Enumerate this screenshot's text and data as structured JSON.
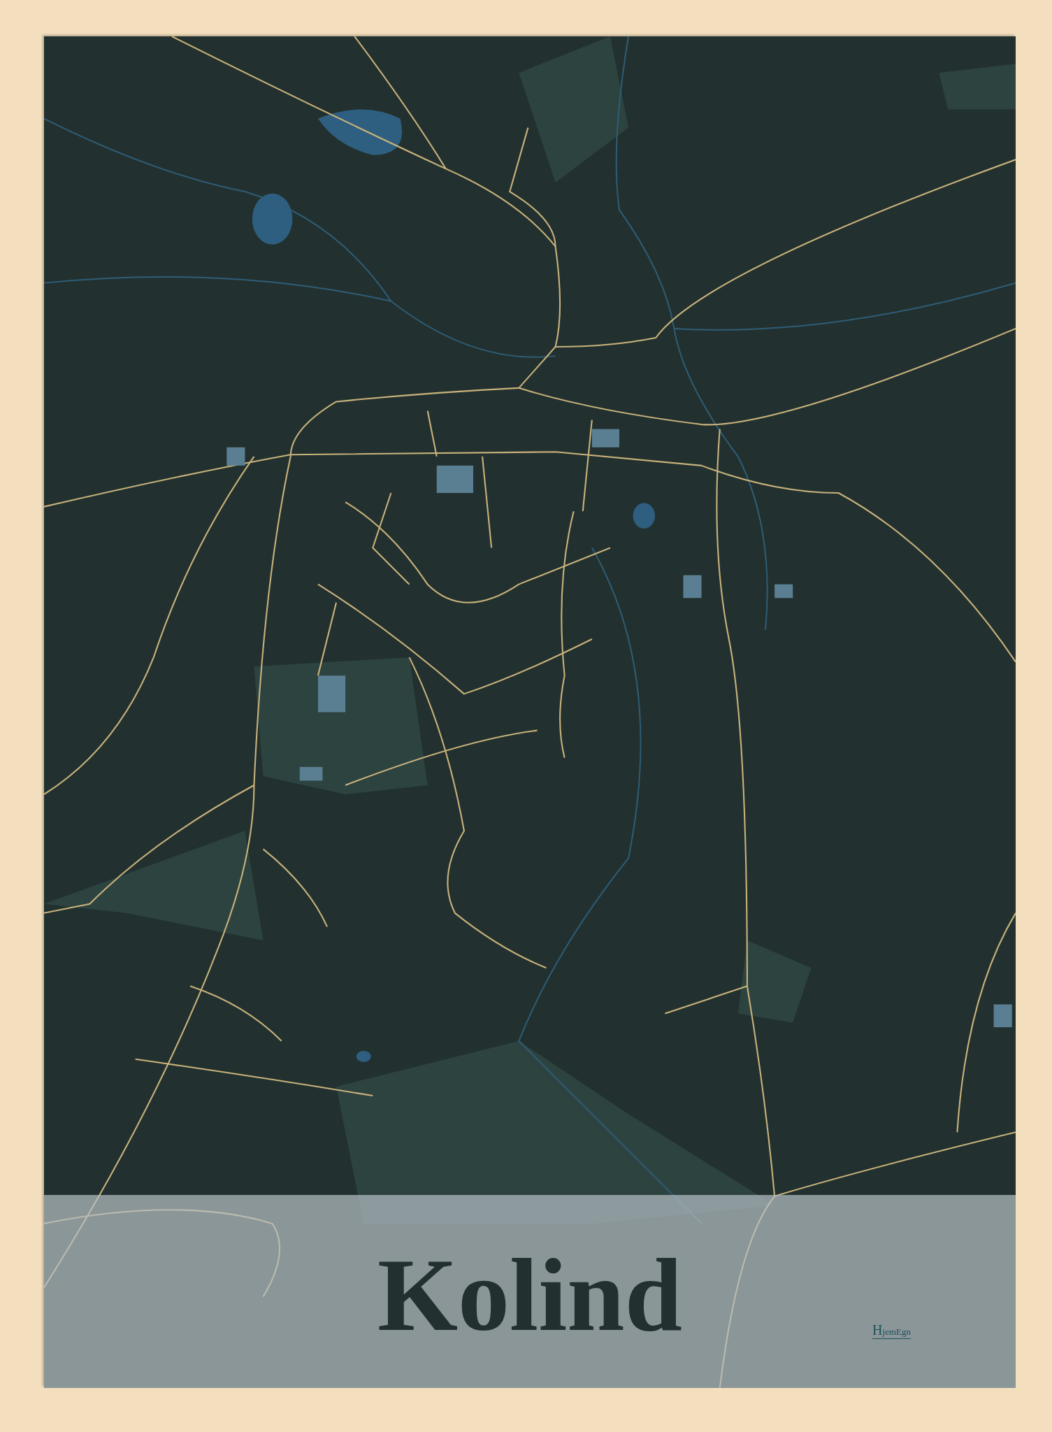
{
  "poster": {
    "title": "Kolind",
    "logo": "HjemEgn"
  }
}
